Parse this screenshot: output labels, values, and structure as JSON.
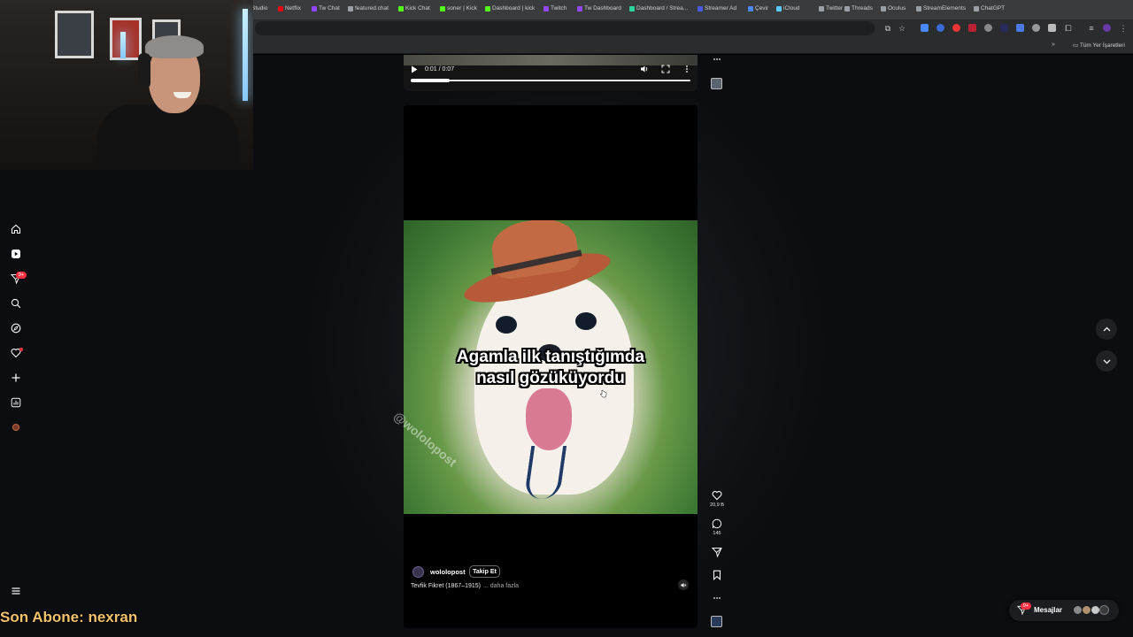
{
  "bookmarks": [
    {
      "label": "Studio",
      "color": "#7a7a7a"
    },
    {
      "label": "Netflix",
      "color": "#e50914"
    },
    {
      "label": "Tw Chat",
      "color": "#9146ff"
    },
    {
      "label": "featured.chat",
      "color": "#9aa0a6"
    },
    {
      "label": "Kick Chat",
      "color": "#53fc18"
    },
    {
      "label": "soner | Kick",
      "color": "#53fc18"
    },
    {
      "label": "Dashboard | kick",
      "color": "#53fc18"
    },
    {
      "label": "Twitch",
      "color": "#9146ff"
    },
    {
      "label": "Tw Dashboard",
      "color": "#9146ff"
    },
    {
      "label": "Dashboard / Strea...",
      "color": "#2bd49a"
    },
    {
      "label": "Streamer Ad",
      "color": "#4a5ae8"
    },
    {
      "label": "Çevir",
      "color": "#4a8af4"
    },
    {
      "label": "iCloud",
      "color": "#5ac8fa"
    },
    {
      "label": "Twitter",
      "color": "#9aa0a6"
    },
    {
      "label": "Threads",
      "color": "#9aa0a6"
    },
    {
      "label": "Oculus",
      "color": "#9aa0a6"
    },
    {
      "label": "StreamElements",
      "color": "#9aa0a6"
    },
    {
      "label": "ChatGPT",
      "color": "#9aa0a6"
    }
  ],
  "bookmarks_more": "»",
  "bookmarks_right": "Tüm Yer İşaretleri",
  "sidebar": {
    "notifications_badge": "9+",
    "subscriber_alert": "Son Abone: nexran"
  },
  "prev_reel": {
    "time": "0:01 / 0:07",
    "progress": 0.14
  },
  "reel": {
    "caption_line1": "Agamla ilk tanıştığımda",
    "caption_line2": "nasıl gözüküyordu",
    "watermark": "@wololopost",
    "author": "wololopost",
    "follow_label": "Takip Et",
    "description": "Tevfik Fikret (1867–1915)",
    "more_label": "... daha fazla",
    "likes": "20,9 B",
    "comments": "145"
  },
  "messages": {
    "label": "Mesajlar",
    "badge": "9+"
  },
  "colors": {
    "accent_badge": "#ff3040",
    "subscriber_alert": "#f2c26b"
  }
}
